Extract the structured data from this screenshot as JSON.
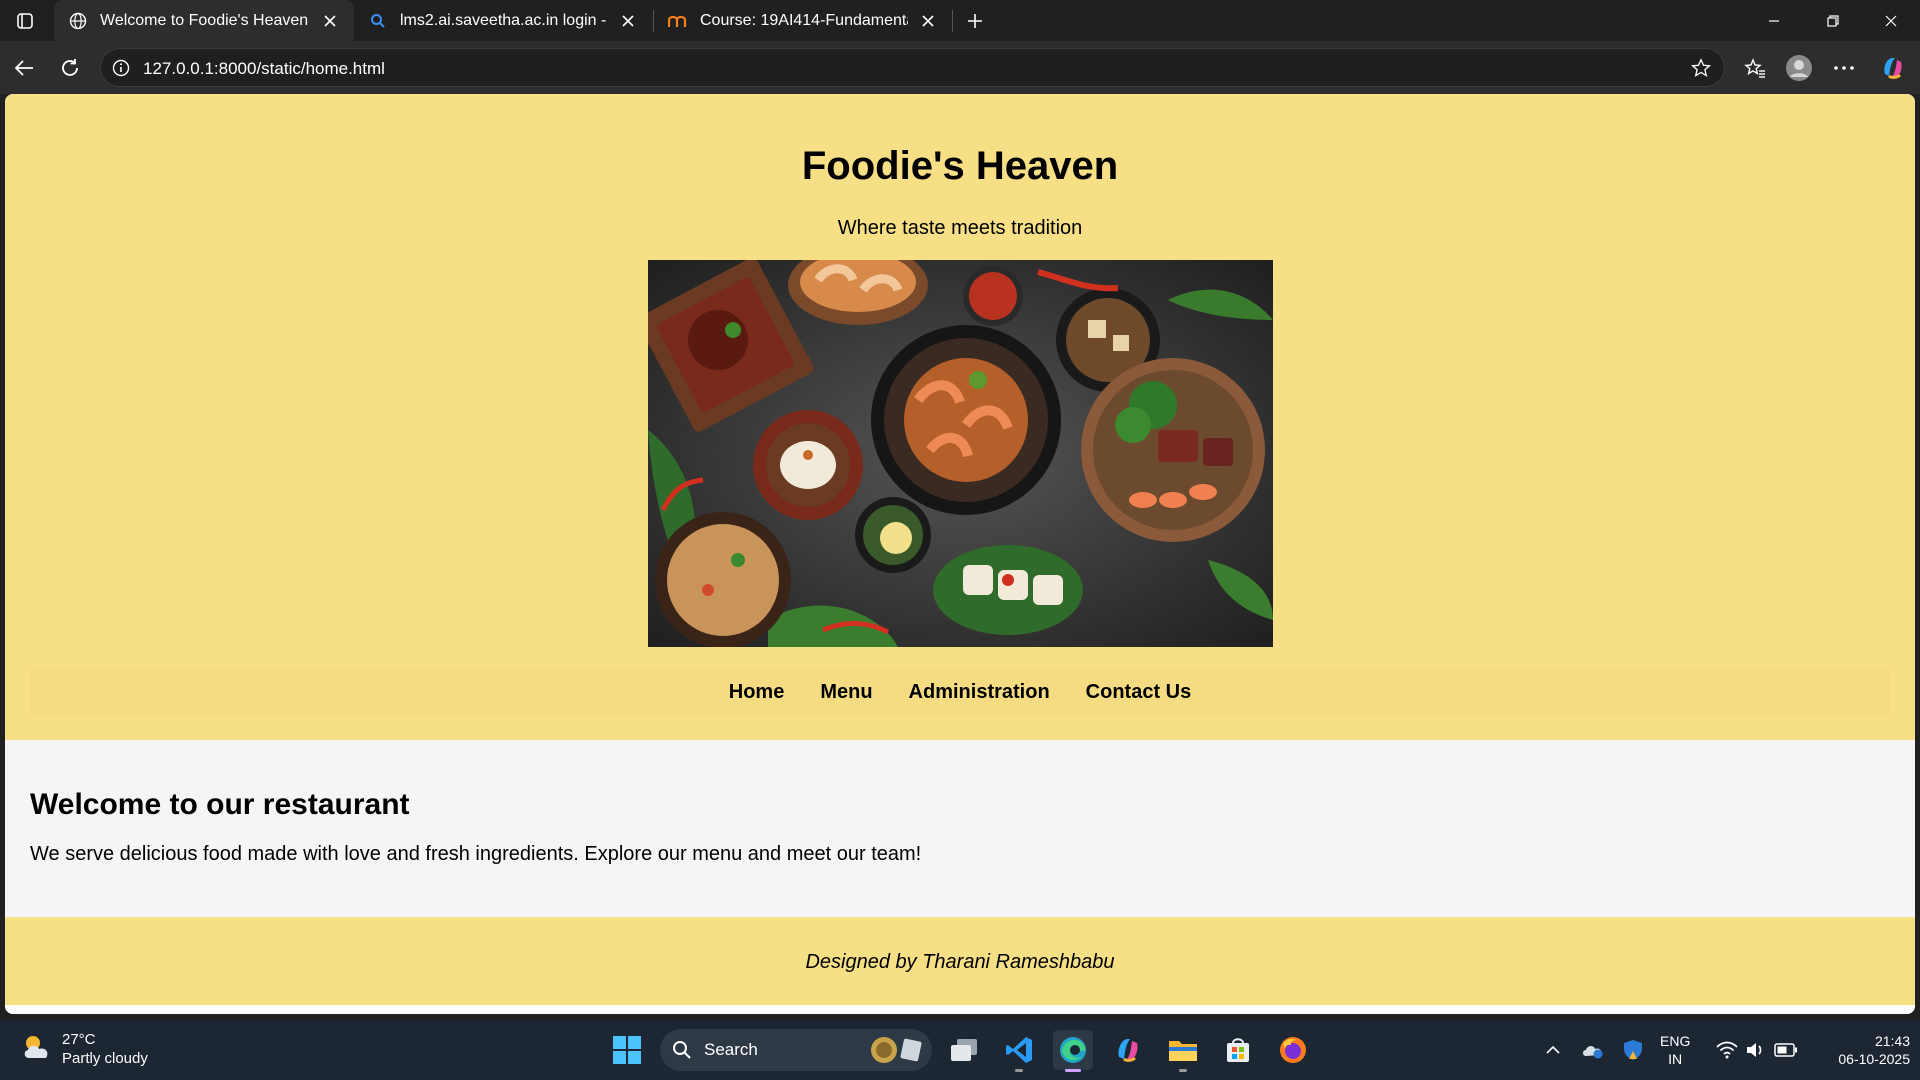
{
  "browser": {
    "tabs": [
      {
        "title": "Welcome to Foodie's Heaven",
        "icon": "globe-icon",
        "active": true
      },
      {
        "title": "lms2.ai.saveetha.ac.in login - Sear",
        "icon": "search-icon",
        "active": false
      },
      {
        "title": "Course: 19AI414-Fundamentals of",
        "icon": "moodle-icon",
        "active": false
      }
    ],
    "address": "127.0.0.1:8000/static/home.html"
  },
  "page": {
    "site_title": "Foodie's Heaven",
    "tagline": "Where taste meets tradition",
    "hero_image": "food-platter-image",
    "nav": [
      {
        "label": "Home"
      },
      {
        "label": "Menu"
      },
      {
        "label": "Administration"
      },
      {
        "label": "Contact Us"
      }
    ],
    "welcome_heading": "Welcome to our restaurant",
    "welcome_text": "We serve delicious food made with love and fresh ingredients. Explore our menu and meet our team!",
    "footer_text": "Designed by Tharani Rameshbabu",
    "colors": {
      "hero_bg": "#f6df85",
      "content_bg": "#f5f5f5"
    }
  },
  "taskbar": {
    "weather_temp": "27°C",
    "weather_desc": "Partly cloudy",
    "search_label": "Search",
    "lang_line1": "ENG",
    "lang_line2": "IN",
    "time": "21:43",
    "date": "06-10-2025"
  }
}
